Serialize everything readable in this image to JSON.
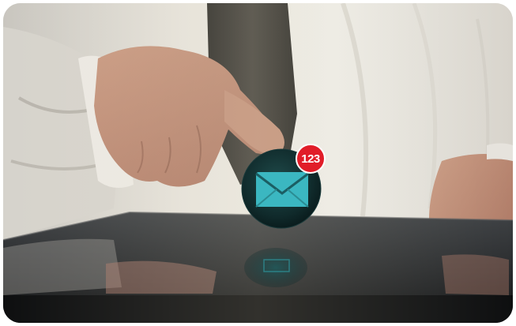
{
  "notification": {
    "count": "123",
    "icon": "envelope-icon",
    "badge_color": "#e11d28",
    "icon_color": "#3bb7c1"
  }
}
